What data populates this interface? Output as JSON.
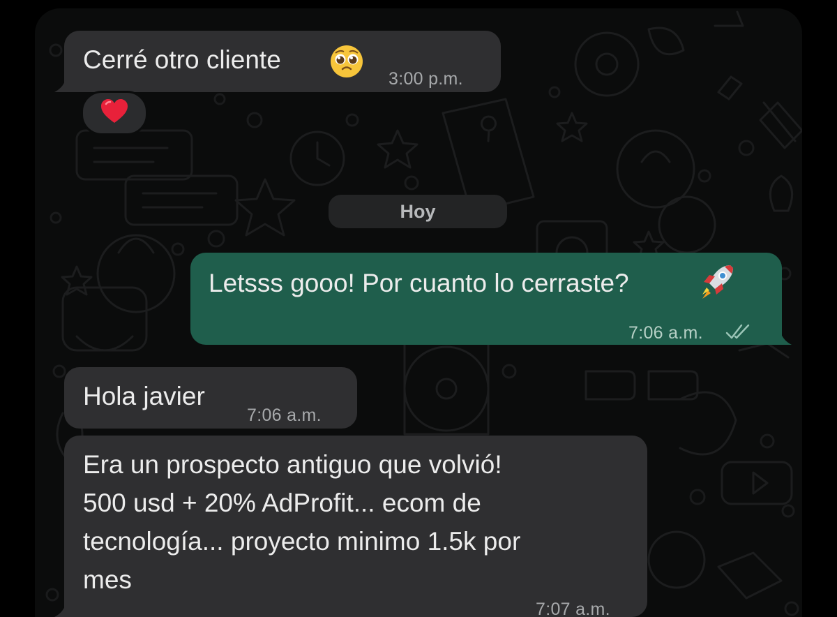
{
  "chat": {
    "date_separator": "Hoy",
    "messages": [
      {
        "direction": "incoming",
        "text": "Cerré otro cliente",
        "emoji": "pleading-face",
        "time": "3:00 p.m.",
        "reaction": "red-heart"
      },
      {
        "direction": "outgoing",
        "text": "Letsss gooo! Por cuanto lo cerraste?",
        "emoji": "rocket",
        "time": "7:06 a.m.",
        "status": "read-double-check"
      },
      {
        "direction": "incoming",
        "text": "Hola javier",
        "time": "7:06 a.m."
      },
      {
        "direction": "incoming",
        "lines": [
          "Era un prospecto antiguo que volvió!",
          "500 usd + 20% AdProfit... ecom de",
          "tecnología... proyecto minimo 1.5k por",
          "mes"
        ],
        "time": "7:07 a.m."
      }
    ]
  },
  "colors": {
    "background": "#0b0c0c",
    "incoming_bubble": "#2f2f31",
    "outgoing_bubble": "#1f5e4c",
    "text": "#ececec",
    "timestamp": "#a7a9ab"
  }
}
